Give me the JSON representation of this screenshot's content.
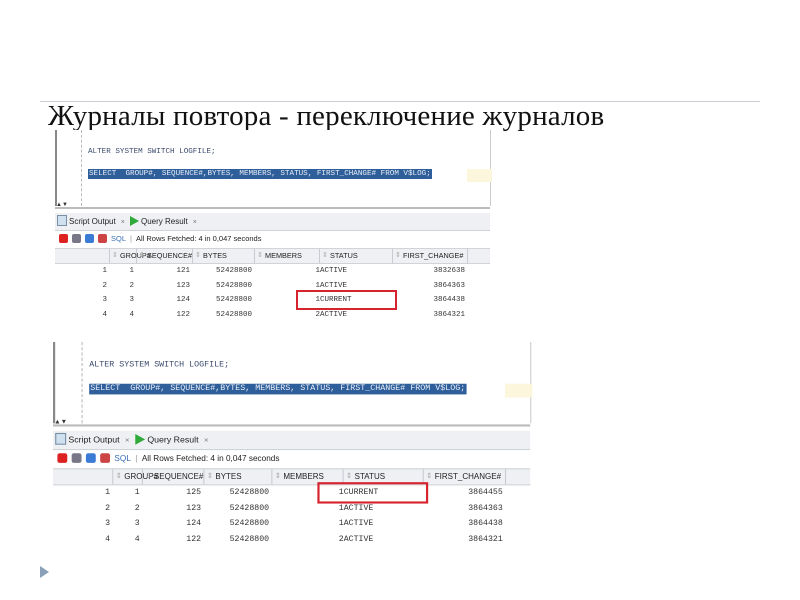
{
  "slide": {
    "title": "Журналы повтора - переключение журналов"
  },
  "panels": [
    {
      "code_line1": "ALTER SYSTEM SWITCH LOGFILE;",
      "code_line2": "SELECT  GROUP#, SEQUENCE#,BYTES, MEMBERS, STATUS, FIRST_CHANGE# FROM V$LOG;",
      "tab_script_output": "Script Output",
      "tab_query_result": "Query Result",
      "sql_label": "SQL",
      "fetch_status": "All Rows Fetched: 4 in 0,047 seconds",
      "columns": [
        "GROUP#",
        "SEQUENCE#",
        "BYTES",
        "MEMBERS",
        "STATUS",
        "FIRST_CHANGE#"
      ],
      "rows": [
        [
          "1",
          "1",
          "121",
          "52428800",
          "1",
          "ACTIVE",
          "3832638"
        ],
        [
          "2",
          "2",
          "123",
          "52428800",
          "1",
          "ACTIVE",
          "3864363"
        ],
        [
          "3",
          "3",
          "124",
          "52428800",
          "1",
          "CURRENT",
          "3864438"
        ],
        [
          "4",
          "4",
          "122",
          "52428800",
          "2",
          "ACTIVE",
          "3864321"
        ]
      ],
      "highlight_row": 2
    },
    {
      "code_line1": "ALTER SYSTEM SWITCH LOGFILE;",
      "code_line2": "SELECT  GROUP#, SEQUENCE#,BYTES, MEMBERS, STATUS, FIRST_CHANGE# FROM V$LOG;",
      "tab_script_output": "Script Output",
      "tab_query_result": "Query Result",
      "sql_label": "SQL",
      "fetch_status": "All Rows Fetched: 4 in 0,047 seconds",
      "columns": [
        "GROUP#",
        "SEQUENCE#",
        "BYTES",
        "MEMBERS",
        "STATUS",
        "FIRST_CHANGE#"
      ],
      "rows": [
        [
          "1",
          "1",
          "125",
          "52428800",
          "1",
          "CURRENT",
          "3864455"
        ],
        [
          "2",
          "2",
          "123",
          "52428800",
          "1",
          "ACTIVE",
          "3864363"
        ],
        [
          "3",
          "3",
          "124",
          "52428800",
          "1",
          "ACTIVE",
          "3864438"
        ],
        [
          "4",
          "4",
          "122",
          "52428800",
          "2",
          "ACTIVE",
          "3864321"
        ]
      ],
      "highlight_row": 0
    }
  ]
}
